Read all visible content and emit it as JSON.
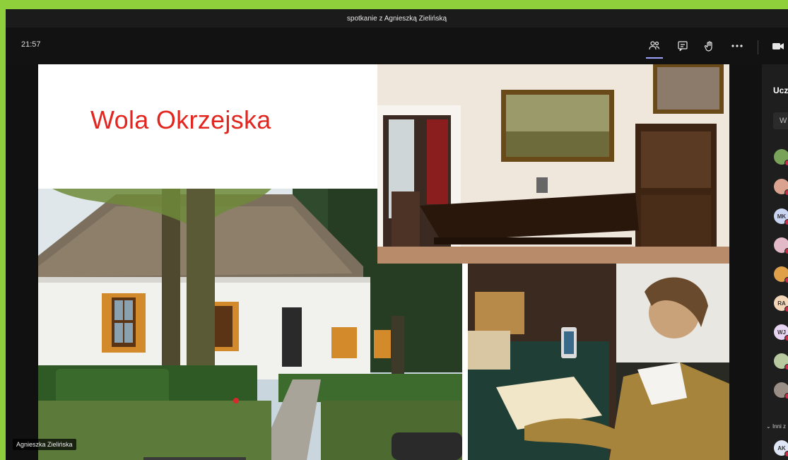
{
  "window": {
    "title": "spotkanie z Agnieszką Zielińską"
  },
  "toolbar": {
    "time": "21:57",
    "icons": [
      "participants-icon",
      "chat-icon",
      "raise-hand-icon",
      "more-icon",
      "camera-icon"
    ]
  },
  "slide": {
    "title": "Wola Okrzejska"
  },
  "speaker": {
    "name": "Agnieszka Zielińska"
  },
  "panel": {
    "title": "Ucz",
    "search_placeholder": "W",
    "participants": [
      {
        "initials": "",
        "color": "#7aa35a"
      },
      {
        "initials": "",
        "color": "#d9a38f"
      },
      {
        "initials": "MK",
        "color": "#c9d4f2"
      },
      {
        "initials": "",
        "color": "#e3b9c8"
      },
      {
        "initials": "",
        "color": "#e0a04a"
      },
      {
        "initials": "RA",
        "color": "#f3d6b8"
      },
      {
        "initials": "WJ",
        "color": "#e8d4f3"
      },
      {
        "initials": "",
        "color": "#b8c9a0"
      },
      {
        "initials": "",
        "color": "#9a8f87"
      }
    ],
    "section_label": "Inni z",
    "others": [
      {
        "initials": "AK",
        "color": "#dfe6f5"
      }
    ]
  }
}
